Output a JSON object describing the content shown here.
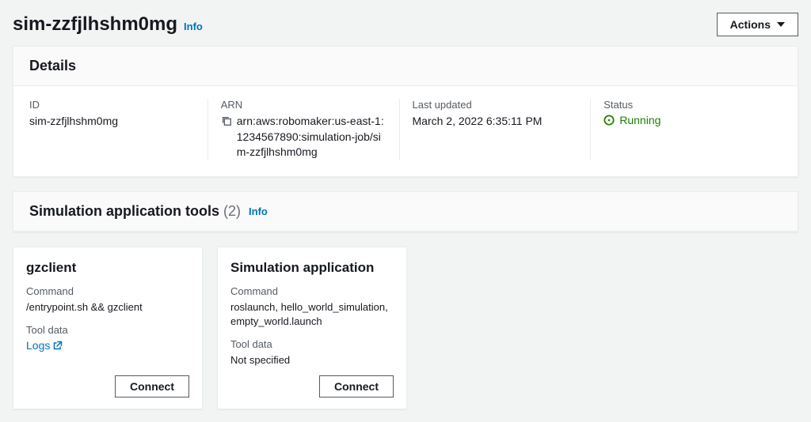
{
  "page": {
    "title": "sim-zzfjlhshm0mg",
    "info": "Info",
    "actions": "Actions"
  },
  "details": {
    "heading": "Details",
    "id_label": "ID",
    "id_value": "sim-zzfjlhshm0mg",
    "arn_label": "ARN",
    "arn_value": "arn:aws:robomaker:us-east-1:1234567890:simulation-job/sim-zzfjlhshm0mg",
    "updated_label": "Last updated",
    "updated_value": "March 2, 2022 6:35:11 PM",
    "status_label": "Status",
    "status_value": "Running"
  },
  "tools_panel": {
    "heading": "Simulation application tools",
    "count": "(2)",
    "info": "Info"
  },
  "tools": [
    {
      "title": "gzclient",
      "command_label": "Command",
      "command_value": "/entrypoint.sh && gzclient",
      "data_label": "Tool data",
      "data_link": "Logs",
      "data_value": "",
      "connect": "Connect"
    },
    {
      "title": "Simulation application",
      "command_label": "Command",
      "command_value": "roslaunch, hello_world_simulation, empty_world.launch",
      "data_label": "Tool data",
      "data_link": "",
      "data_value": "Not specified",
      "connect": "Connect"
    }
  ]
}
